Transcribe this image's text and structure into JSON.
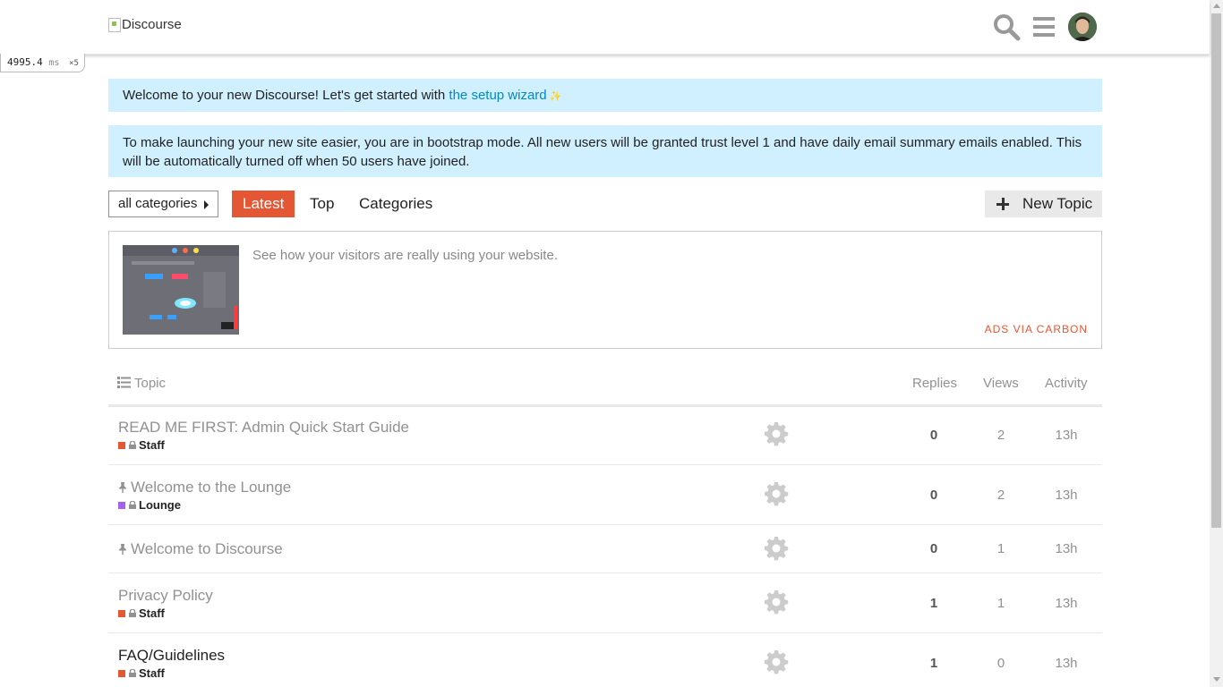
{
  "header": {
    "logo_alt": "Discourse",
    "icons": [
      "search-icon",
      "hamburger-menu-icon",
      "avatar"
    ]
  },
  "timing": {
    "value": "4995.4",
    "unit": "ms",
    "count": "×5"
  },
  "notices": {
    "welcome_prefix": "Welcome to your new Discourse! Let's get started with ",
    "welcome_link": "the setup wizard",
    "bootstrap": "To make launching your new site easier, you are in bootstrap mode. All new users will be granted trust level 1 and have daily email summary emails enabled. This will be automatically turned off when 50 users have joined."
  },
  "nav": {
    "category_dropdown": "all categories",
    "tabs": [
      "Latest",
      "Top",
      "Categories"
    ],
    "active_tab": "Latest",
    "new_topic": "New Topic"
  },
  "ad": {
    "text": "See how your visitors are really using your website.",
    "via": "ADS VIA CARBON"
  },
  "table": {
    "headers": {
      "topic": "Topic",
      "replies": "Replies",
      "views": "Views",
      "activity": "Activity"
    },
    "rows": [
      {
        "title": "READ ME FIRST: Admin Quick Start Guide",
        "pinned": false,
        "category": "Staff",
        "category_color": "#e45735",
        "replies": "0",
        "views": "2",
        "activity": "13h"
      },
      {
        "title": "Welcome to the Lounge",
        "pinned": true,
        "category": "Lounge",
        "category_color": "#a461ef",
        "replies": "0",
        "views": "2",
        "activity": "13h"
      },
      {
        "title": "Welcome to Discourse",
        "pinned": true,
        "category": "",
        "category_color": "",
        "replies": "0",
        "views": "1",
        "activity": "13h"
      },
      {
        "title": "Privacy Policy",
        "pinned": false,
        "category": "Staff",
        "category_color": "#e45735",
        "replies": "1",
        "views": "1",
        "activity": "13h"
      },
      {
        "title": "FAQ/Guidelines",
        "pinned": false,
        "category": "Staff",
        "category_color": "#e45735",
        "replies": "1",
        "views": "0",
        "activity": "13h"
      }
    ]
  },
  "colors": {
    "accent": "#e45735",
    "notice_bg": "#d1f0ff",
    "link": "#0088cc"
  }
}
